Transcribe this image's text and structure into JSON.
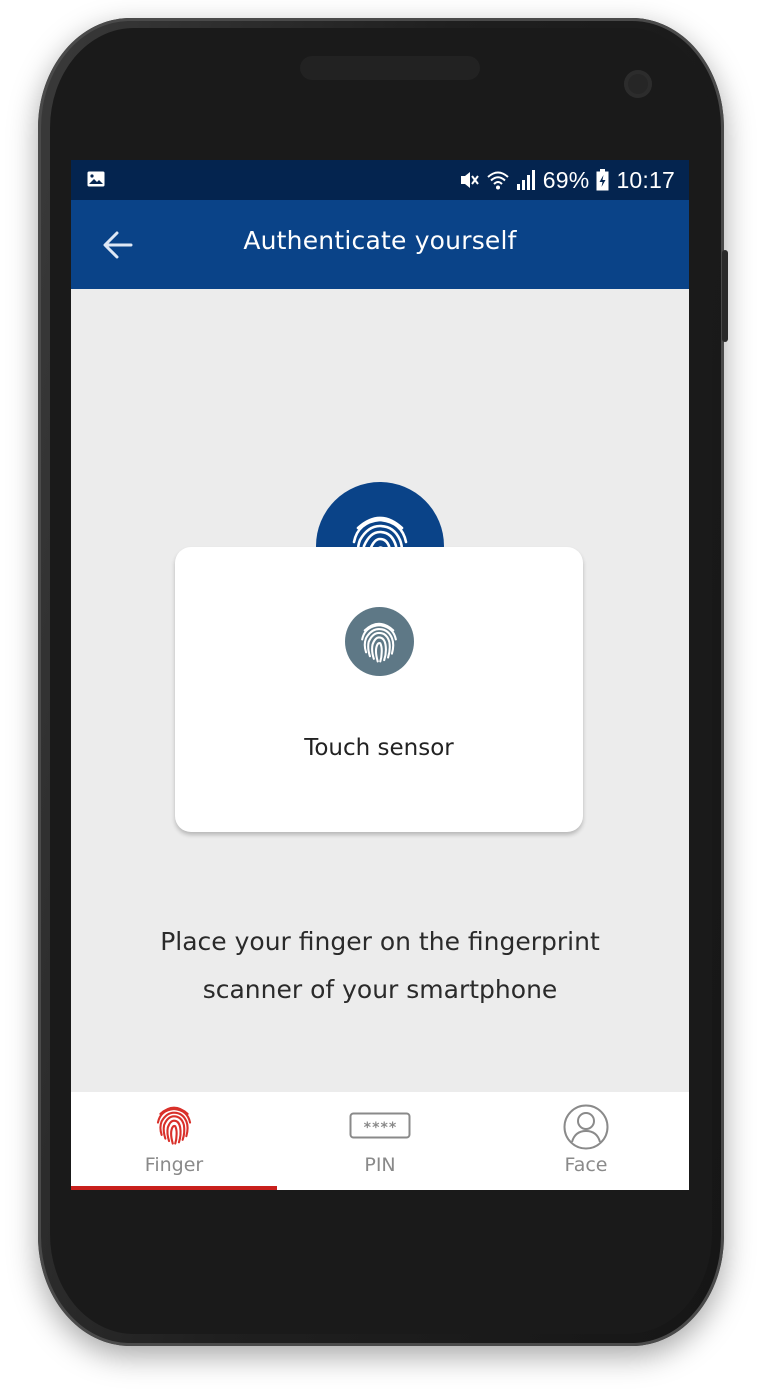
{
  "status_bar": {
    "battery_percent": "69%",
    "time": "10:17",
    "icons": [
      "gallery-icon",
      "vibrate-mute-icon",
      "wifi-icon",
      "signal-icon",
      "battery-icon"
    ]
  },
  "app_bar": {
    "title": "Authenticate yourself",
    "back_icon": "arrow-left-icon"
  },
  "dialog": {
    "icon": "fingerprint-icon",
    "text": "Touch sensor"
  },
  "instruction": {
    "line1": "Place your finger on the fingerprint",
    "line2": "scanner of your smartphone"
  },
  "bottom_nav": {
    "tabs": [
      {
        "label": "Finger",
        "icon": "fingerprint-icon",
        "active": true
      },
      {
        "label": "PIN",
        "icon": "pin-keypad-icon",
        "active": false,
        "icon_text": "****"
      },
      {
        "label": "Face",
        "icon": "face-user-icon",
        "active": false
      }
    ]
  },
  "colors": {
    "primary": "#0a4388",
    "status_bar": "#04244f",
    "accent": "#c8201c",
    "background": "#ececec",
    "dialog_icon": "#5e7886"
  }
}
